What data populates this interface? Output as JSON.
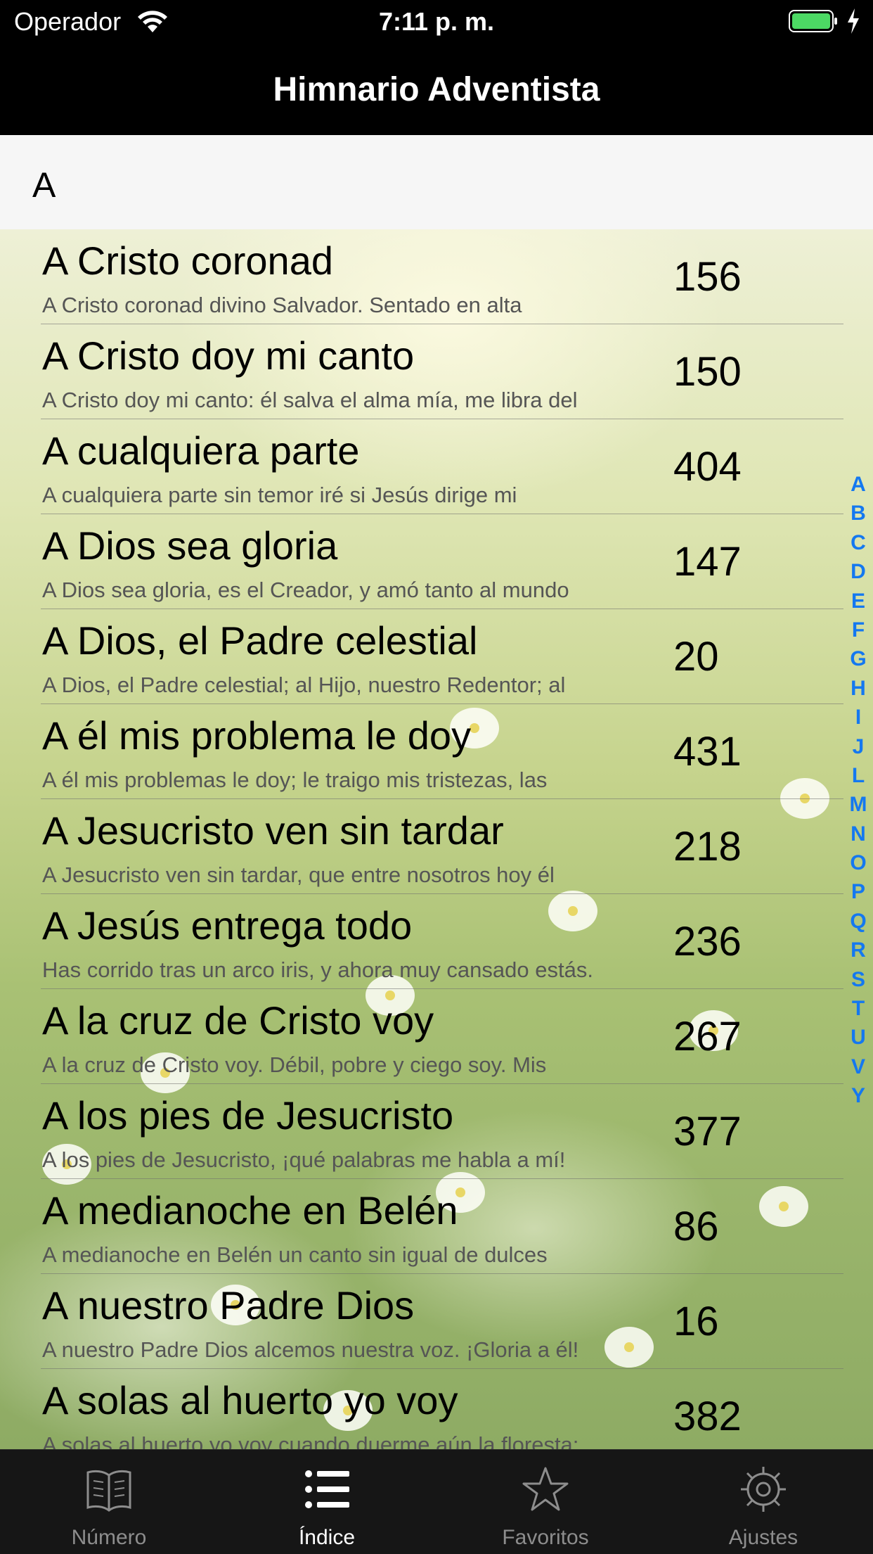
{
  "status": {
    "carrier": "Operador",
    "time": "7:11 p. m."
  },
  "nav": {
    "title": "Himnario Adventista"
  },
  "section": {
    "letter": "A"
  },
  "hymns": [
    {
      "title": "A Cristo coronad",
      "subtitle": "A Cristo coronad divino Salvador. Sentado en alta",
      "number": "156"
    },
    {
      "title": "A Cristo doy mi canto",
      "subtitle": "A Cristo doy mi canto: él salva el alma mía, me libra del",
      "number": "150"
    },
    {
      "title": "A cualquiera parte",
      "subtitle": "A cualquiera parte sin temor iré si Jesús dirige mi",
      "number": "404"
    },
    {
      "title": "A Dios sea gloria",
      "subtitle": "A Dios sea gloria, es el Creador, y amó tanto al mundo",
      "number": "147"
    },
    {
      "title": "A Dios, el Padre celestial",
      "subtitle": "A Dios, el Padre celestial; al Hijo, nuestro Redentor; al",
      "number": "20"
    },
    {
      "title": "A él mis problema le doy",
      "subtitle": "A él mis problemas le doy; le traigo mis tristezas, las",
      "number": "431"
    },
    {
      "title": "A Jesucristo ven sin tardar",
      "subtitle": "A Jesucristo ven sin tardar, que entre nosotros hoy él",
      "number": "218"
    },
    {
      "title": "A Jesús entrega todo",
      "subtitle": "Has corrido tras un arco iris, y ahora muy cansado estás.",
      "number": "236"
    },
    {
      "title": "A la cruz de Cristo voy",
      "subtitle": "A la cruz de Cristo voy. Débil, pobre y ciego soy. Mis",
      "number": "267"
    },
    {
      "title": "A los pies de Jesucristo",
      "subtitle": "A los pies de Jesucristo, ¡qué palabras me habla a mí!",
      "number": "377"
    },
    {
      "title": "A medianoche en Belén",
      "subtitle": "A medianoche en Belén un canto sin igual de dulces",
      "number": "86"
    },
    {
      "title": "A nuestro Padre Dios",
      "subtitle": "A nuestro Padre Dios alcemos nuestra voz. ¡Gloria a él!",
      "number": "16"
    },
    {
      "title": "A solas al huerto yo voy",
      "subtitle": "A solas al huerto yo voy cuando duerme aún la floresta;",
      "number": "382"
    }
  ],
  "index_letters": [
    "A",
    "B",
    "C",
    "D",
    "E",
    "F",
    "G",
    "H",
    "I",
    "J",
    "L",
    "M",
    "N",
    "O",
    "P",
    "Q",
    "R",
    "S",
    "T",
    "U",
    "V",
    "Y"
  ],
  "tabs": [
    {
      "label": "Número",
      "icon": "book-icon",
      "active": false
    },
    {
      "label": "Índice",
      "icon": "list-icon",
      "active": true
    },
    {
      "label": "Favoritos",
      "icon": "star-icon",
      "active": false
    },
    {
      "label": "Ajustes",
      "icon": "gear-icon",
      "active": false
    }
  ],
  "colors": {
    "index_blue": "#1478f0",
    "battery_green": "#4cd964",
    "tab_inactive": "#8d8d8d"
  }
}
